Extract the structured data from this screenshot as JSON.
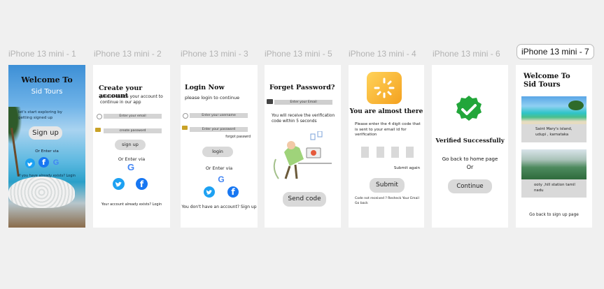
{
  "frames": {
    "f1": {
      "label": "iPhone 13 mini - 1",
      "title": "Welcome To",
      "subtitle": "Sid Tours",
      "tagline": "let's start exploring by getting signed up",
      "signup_button": "Sign up",
      "or_enter": "Or Enter via",
      "already": "If you have already exists? Login"
    },
    "f2": {
      "label": "iPhone 13 mini - 2",
      "title": "Create your account",
      "desc": "please create your account to continue in our app",
      "email_placeholder": "Enter your email",
      "password_placeholder": "create password",
      "signup_button": "sign up",
      "or_enter": "Or Enter via",
      "footer": "Your account already exists? Login"
    },
    "f3": {
      "label": "iPhone 13 mini - 3",
      "title": "Login Now",
      "desc": "please login to continue",
      "username_placeholder": "Enter your username",
      "password_placeholder": "Enter your password",
      "forgot": "forgot passwrd",
      "login_button": "login",
      "or_enter": "Or Enter via",
      "footer": "You don't have an account? Sign up"
    },
    "f5": {
      "label": "iPhone 13 mini - 5",
      "title": "Forget Password?",
      "email_placeholder": "Enter your Email",
      "desc": "You will receive the verification code within 5 seconds",
      "send_button": "Send code"
    },
    "f4": {
      "label": "iPhone 13 mini - 4",
      "title": "You are almost there",
      "desc": "Please enter the 4 digit code that is sent to your email id for verification",
      "submit_again": "Submit again",
      "submit_button": "Submit",
      "footer": "Code not received ? Resheck Your Email Go back"
    },
    "f6": {
      "label": "iPhone 13 mini - 6",
      "title": "Verified Successfully",
      "home": "Go back to home page",
      "or": "Or",
      "continue_button": "Continue"
    },
    "f7": {
      "label": "iPhone 13 mini - 7",
      "title": "Welcome To Sid Tours",
      "card1": "Saint Mary's  island, udupi , karnataka",
      "card2": "ooty ,hill station tamil nadu",
      "footer": "Go back to sign up page"
    }
  },
  "colors": {
    "canvas": "#f0f0f0",
    "google_blue": "#4285f4",
    "facebook": "#1877f2",
    "twitter": "#1da1f2",
    "verified_green": "#22a63a",
    "loader_orange": "#f4a11f"
  },
  "icons": [
    "twitter-icon",
    "facebook-icon",
    "google-icon",
    "user-icon",
    "lock-icon",
    "email-icon",
    "loader-icon",
    "check-icon"
  ]
}
